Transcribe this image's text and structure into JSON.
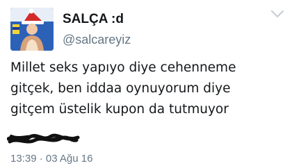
{
  "author": {
    "display_name": "SALÇA :d",
    "handle": "@salcareyiz"
  },
  "tweet": {
    "lines": [
      "Millet seks yapıyo diye cehenneme",
      "gitçek, ben iddaa oynuyorum diye",
      "gitçem üstelik kupon da tutmuyor"
    ],
    "timestamp": "13:39 · 03 Ağu 16"
  },
  "icons": {
    "menu": "chevron-down-icon",
    "redaction": "scribble-redaction"
  },
  "colors": {
    "name": "#14171a",
    "secondary": "#657786",
    "avatar_bg": "#2b62b8"
  }
}
